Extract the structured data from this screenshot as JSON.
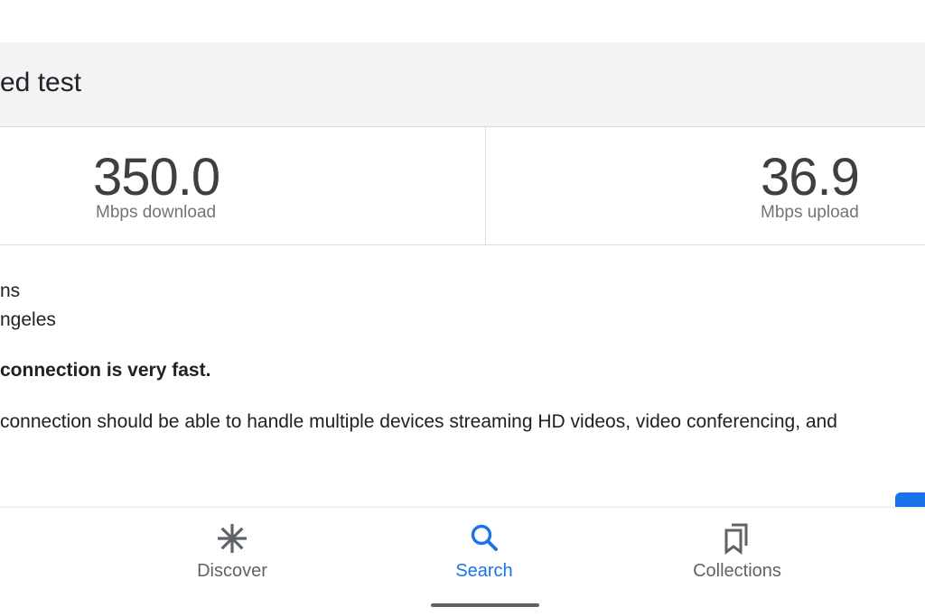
{
  "header": {
    "title": "ed test"
  },
  "results": {
    "download": {
      "value": "350.0",
      "label": "Mbps download"
    },
    "upload": {
      "value": "36.9",
      "label": "Mbps upload"
    }
  },
  "details": {
    "line_1": "ns",
    "line_2": "ngeles",
    "verdict": "connection is very fast.",
    "description": "connection should be able to handle multiple devices streaming HD videos, video conferencing, and"
  },
  "bottom_nav": {
    "items": [
      {
        "label": "Discover",
        "icon": "asterisk-icon",
        "active": false
      },
      {
        "label": "Search",
        "icon": "search-icon",
        "active": true
      },
      {
        "label": "Collections",
        "icon": "bookmarks-icon",
        "active": false
      }
    ]
  },
  "colors": {
    "accent": "#1a73e8",
    "header_bg": "#f1f3f4",
    "divider": "#dadce0",
    "text": "#202124",
    "secondary_text": "#70757a"
  }
}
